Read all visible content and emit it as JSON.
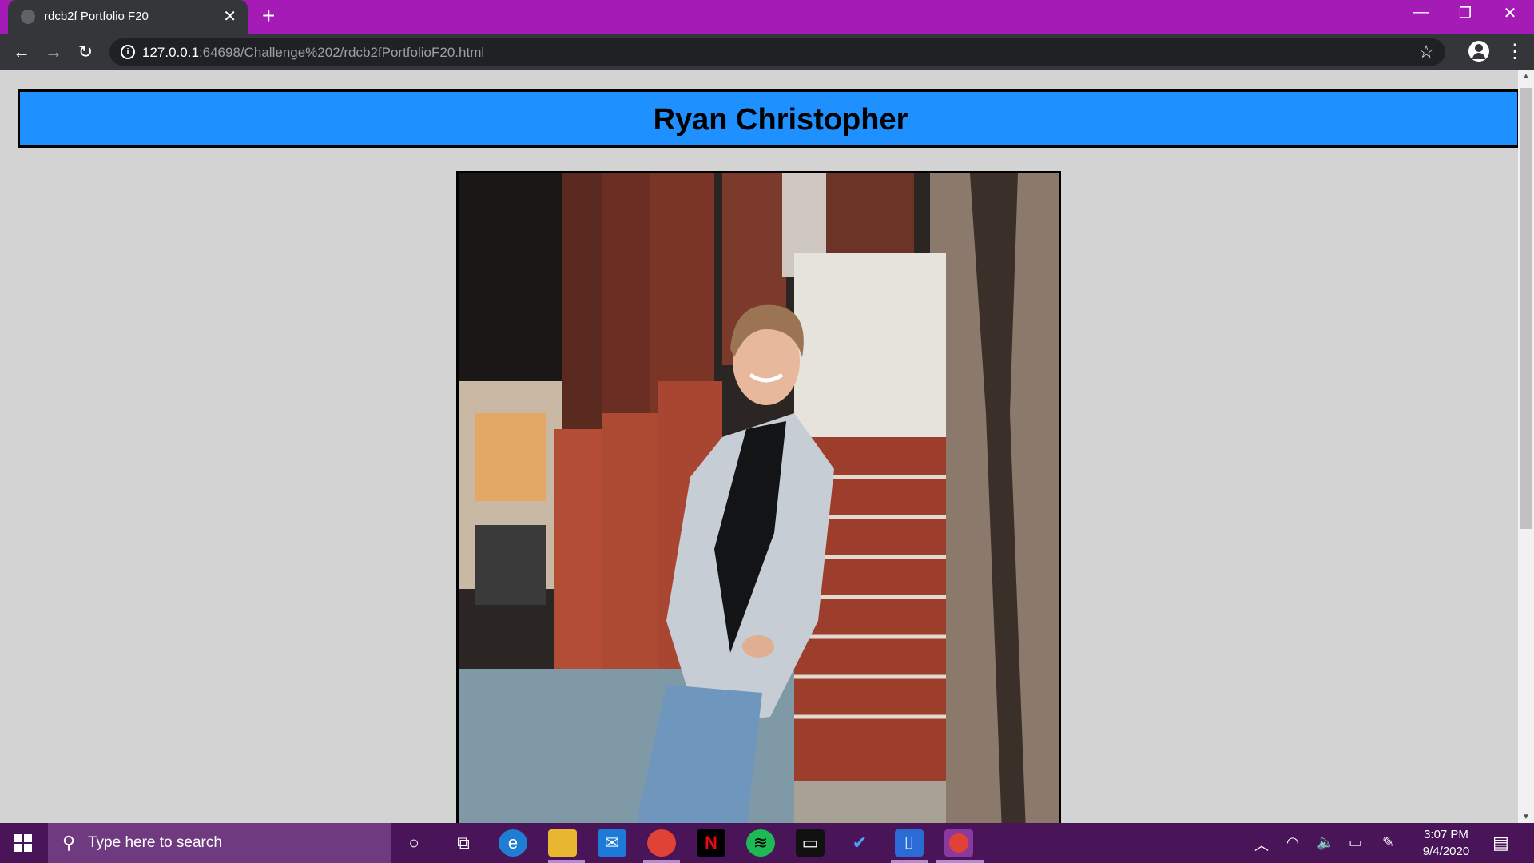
{
  "browser": {
    "tab_title": "rdcb2f Portfolio F20",
    "tab_close": "✕",
    "new_tab": "+",
    "url_host": "127.0.0.1",
    "url_rest": ":64698/Challenge%202/rdcb2fPortfolioF20.html",
    "window_controls": {
      "minimize": "—",
      "restore": "❐",
      "close": "✕"
    },
    "nav": {
      "back": "←",
      "forward": "→",
      "reload": "↻"
    },
    "info_icon": "i",
    "star_icon": "☆",
    "menu_icon": "⋮"
  },
  "page": {
    "title": "Ryan Christopher"
  },
  "taskbar": {
    "search_placeholder": "Type here to search",
    "time": "3:07 PM",
    "date": "9/4/2020"
  },
  "colors": {
    "title_bar": "#a41bb6",
    "banner": "#1e90ff",
    "page_background": "#d3d3d3",
    "taskbar": "#4a1558"
  }
}
